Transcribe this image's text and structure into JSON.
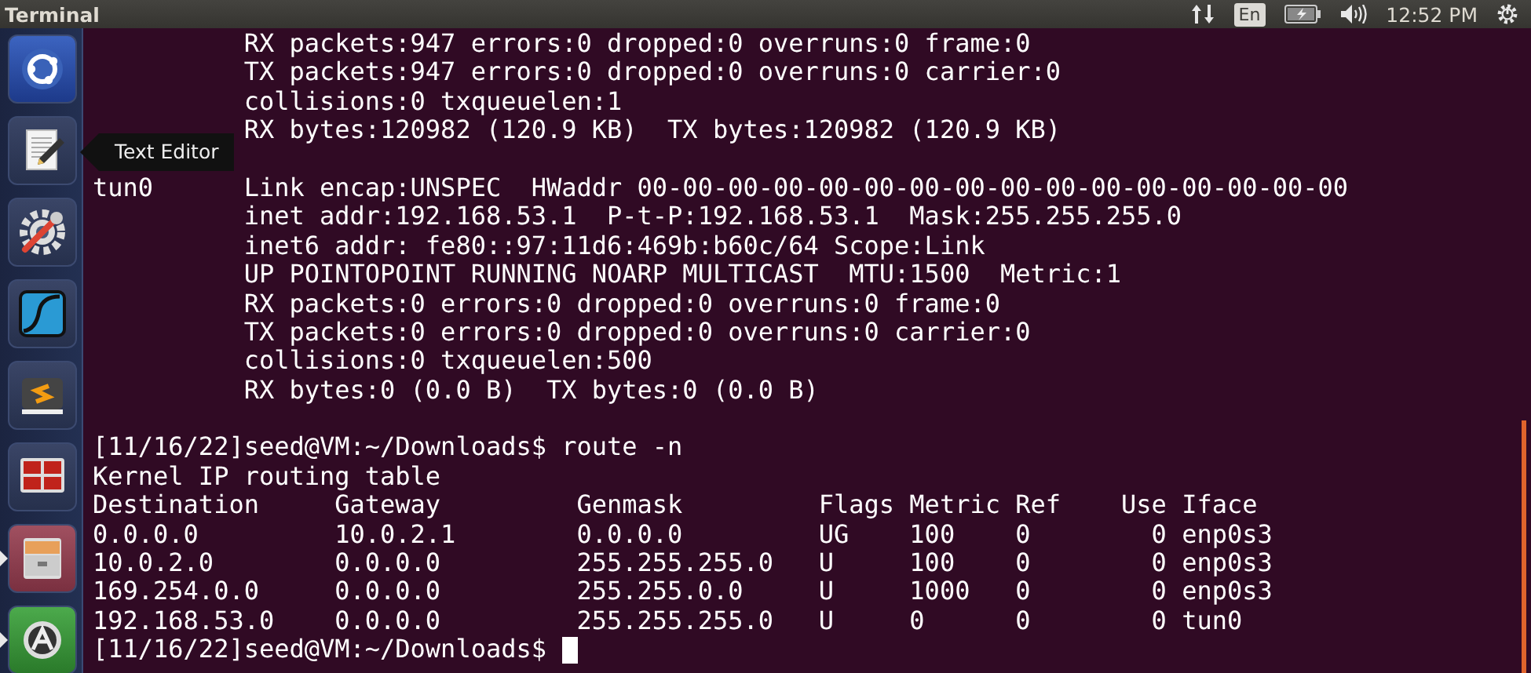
{
  "top_bar": {
    "title": "Terminal",
    "keyboard_layout": "En",
    "clock": "12:52 PM"
  },
  "launcher": {
    "items": [
      {
        "kind": "dash",
        "running": false
      },
      {
        "kind": "editor",
        "running": false
      },
      {
        "kind": "settings",
        "running": false
      },
      {
        "kind": "wave",
        "running": false
      },
      {
        "kind": "sublime",
        "running": false
      },
      {
        "kind": "panels",
        "running": false
      },
      {
        "kind": "cabinet",
        "running": true
      },
      {
        "kind": "updater",
        "running": true
      }
    ]
  },
  "tooltip": {
    "text": "Text Editor"
  },
  "terminal": {
    "cursor": true,
    "blocks": [
      [
        "          RX packets:947 errors:0 dropped:0 overruns:0 frame:0",
        "          TX packets:947 errors:0 dropped:0 overruns:0 carrier:0",
        "          collisions:0 txqueuelen:1",
        "          RX bytes:120982 (120.9 KB)  TX bytes:120982 (120.9 KB)"
      ],
      [
        "tun0      Link encap:UNSPEC  HWaddr 00-00-00-00-00-00-00-00-00-00-00-00-00-00-00-00",
        "          inet addr:192.168.53.1  P-t-P:192.168.53.1  Mask:255.255.255.0",
        "          inet6 addr: fe80::97:11d6:469b:b60c/64 Scope:Link",
        "          UP POINTOPOINT RUNNING NOARP MULTICAST  MTU:1500  Metric:1",
        "          RX packets:0 errors:0 dropped:0 overruns:0 frame:0",
        "          TX packets:0 errors:0 dropped:0 overruns:0 carrier:0",
        "          collisions:0 txqueuelen:500",
        "          RX bytes:0 (0.0 B)  TX bytes:0 (0.0 B)"
      ],
      [
        "[11/16/22]seed@VM:~/Downloads$ route -n",
        "Kernel IP routing table",
        "Destination     Gateway         Genmask         Flags Metric Ref    Use Iface",
        "0.0.0.0         10.0.2.1        0.0.0.0         UG    100    0        0 enp0s3",
        "10.0.2.0        0.0.0.0         255.255.255.0   U     100    0        0 enp0s3",
        "169.254.0.0     0.0.0.0         255.255.0.0     U     1000   0        0 enp0s3",
        "192.168.53.0    0.0.0.0         255.255.255.0   U     0      0        0 tun0",
        "[11/16/22]seed@VM:~/Downloads$"
      ]
    ]
  }
}
